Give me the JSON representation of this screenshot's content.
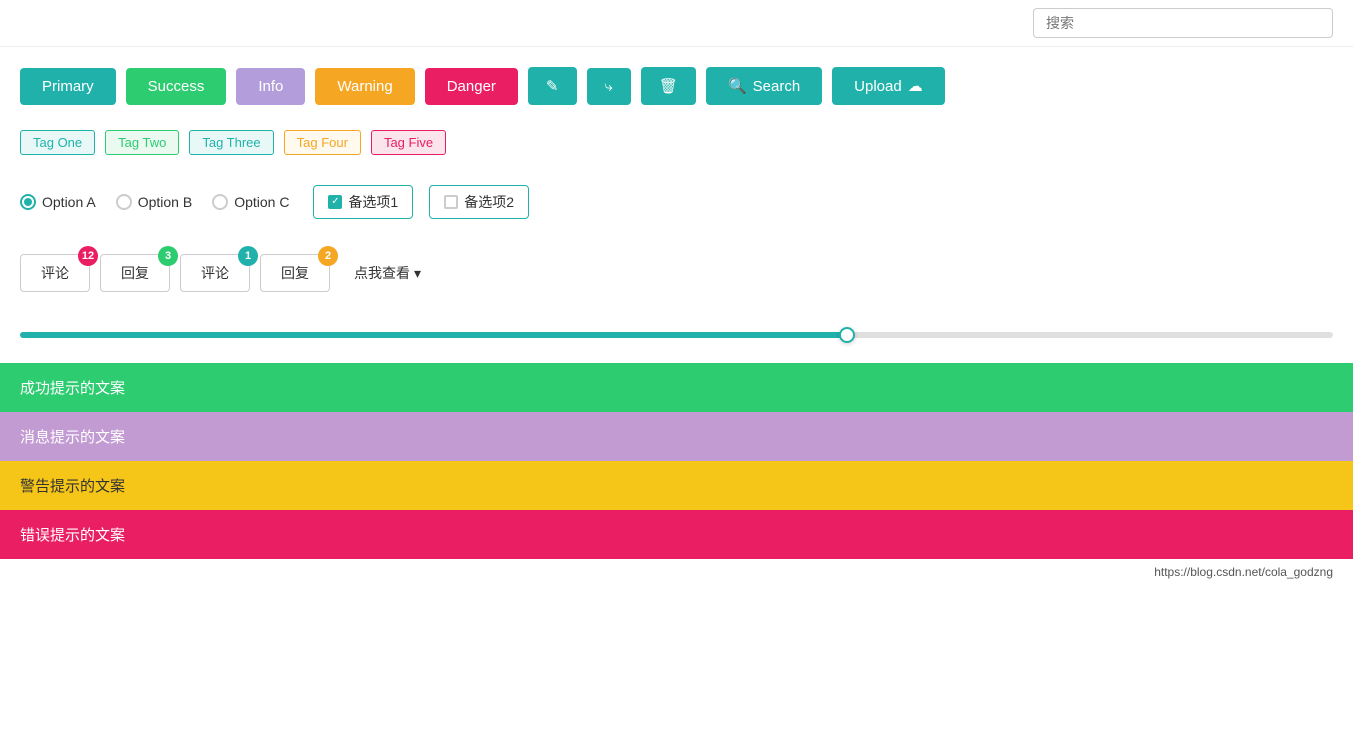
{
  "topbar": {
    "search_placeholder": "搜索"
  },
  "buttons": {
    "primary": "Primary",
    "success": "Success",
    "info": "Info",
    "warning": "Warning",
    "danger": "Danger",
    "search": "Search",
    "upload": "Upload"
  },
  "tags": {
    "one": "Tag One",
    "two": "Tag Two",
    "three": "Tag Three",
    "four": "Tag Four",
    "five": "Tag Five"
  },
  "options": {
    "radio": [
      {
        "label": "Option A",
        "checked": true
      },
      {
        "label": "Option B",
        "checked": false
      },
      {
        "label": "Option C",
        "checked": false
      }
    ],
    "checkbox1_label": "备选项1",
    "checkbox2_label": "备选项2",
    "checkbox1_checked": true,
    "checkbox2_checked": false
  },
  "badges": {
    "btn1_label": "评论",
    "btn1_badge": "12",
    "btn2_label": "回复",
    "btn2_badge": "3",
    "btn3_label": "评论",
    "btn3_badge": "1",
    "btn4_label": "回复",
    "btn4_badge": "2",
    "dropdown_label": "点我查看"
  },
  "slider": {
    "fill_percent": 63
  },
  "alerts": {
    "success": "成功提示的文案",
    "info": "消息提示的文案",
    "warning": "警告提示的文案",
    "danger": "错误提示的文案"
  },
  "footer": {
    "link": "https://blog.csdn.net/cola_godzng"
  }
}
